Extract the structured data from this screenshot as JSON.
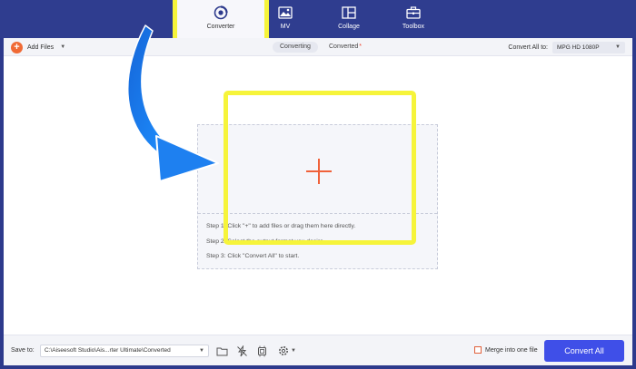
{
  "nav": {
    "tabs": [
      {
        "label": "Converter",
        "icon": "converter-icon",
        "active": true
      },
      {
        "label": "MV",
        "icon": "mv-image-icon"
      },
      {
        "label": "Collage",
        "icon": "collage-icon"
      },
      {
        "label": "Toolbox",
        "icon": "toolbox-icon"
      }
    ]
  },
  "toolbar": {
    "add_files_label": "Add Files",
    "subtabs": [
      {
        "label": "Converting",
        "active": true
      },
      {
        "label": "Converted",
        "badge": "*"
      }
    ],
    "convert_all_to_label": "Convert All to:",
    "format_value": "MPG HD 1080P"
  },
  "dropzone": {
    "steps": [
      "Step 1: Click \"+\" to add files or drag them here directly.",
      "Step 2: Select the output format you desire.",
      "Step 3: Click \"Convert All\" to start."
    ]
  },
  "bottom": {
    "save_to_label": "Save to:",
    "save_path": "C:\\Aiseesoft Studio\\Ais...rter Ultimate\\Converted",
    "merge_label": "Merge into one file",
    "convert_all_button": "Convert All"
  },
  "colors": {
    "nav_bg": "#2f3d8f",
    "accent_orange": "#f06a35",
    "primary_button": "#3f4fe8",
    "highlight_yellow": "#f6f43a",
    "arrow_blue": "#1e7fe8"
  }
}
